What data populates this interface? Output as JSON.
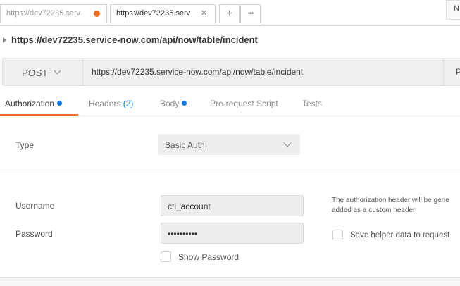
{
  "tabs": [
    {
      "label": "https://dev72235.serv",
      "unsaved": true
    },
    {
      "label": "https://dev72235.serv",
      "active": true
    }
  ],
  "tab_controls": {
    "close_icon": "×",
    "add_icon": "+",
    "more_icon": "•••"
  },
  "environment_button": "N",
  "request": {
    "title": "https://dev72235.service-now.com/api/now/table/incident",
    "method": "POST",
    "url": "https://dev72235.service-now.com/api/now/table/incident",
    "params_label": "P"
  },
  "subtabs": {
    "authorization": "Authorization",
    "headers": "Headers",
    "headers_count": "(2)",
    "body": "Body",
    "prerequest": "Pre-request Script",
    "tests": "Tests"
  },
  "auth": {
    "type_label": "Type",
    "type_value": "Basic Auth",
    "username_label": "Username",
    "username_value": "cti_account",
    "password_label": "Password",
    "password_value": "••••••••••",
    "show_password_label": "Show Password",
    "note_line1": "The authorization header will be gene",
    "note_line2": "added as a custom header",
    "save_helper_label": "Save helper data to request"
  },
  "colors": {
    "accent": "#f26b1d",
    "blue": "#097bed"
  }
}
